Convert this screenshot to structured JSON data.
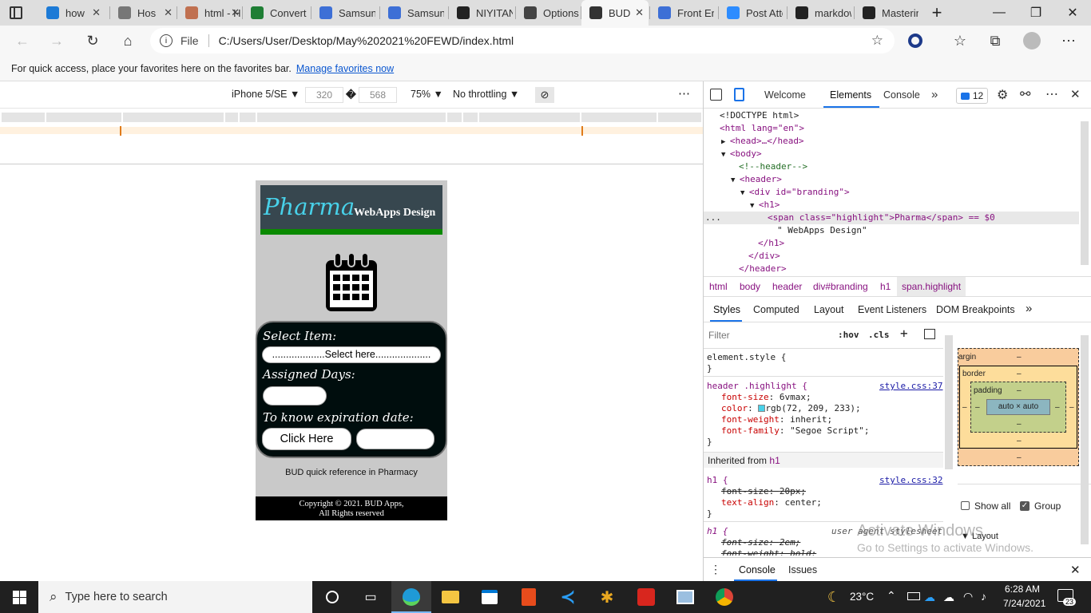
{
  "tabs": [
    {
      "label": "how",
      "icon": "bing-icon",
      "color": "#1c7ad6"
    },
    {
      "label": "Hos",
      "icon": "hosting-icon",
      "color": "#777"
    },
    {
      "label": "html - H",
      "icon": "page-icon",
      "color": "#c07050"
    },
    {
      "label": "Convert",
      "icon": "convert-icon",
      "color": "#1e7e34"
    },
    {
      "label": "Samsung",
      "icon": "samsung-icon",
      "color": "#3d6fd6"
    },
    {
      "label": "Samsung",
      "icon": "samsung-icon",
      "color": "#3d6fd6"
    },
    {
      "label": "NIYITANG",
      "icon": "github-icon",
      "color": "#222"
    },
    {
      "label": "Options",
      "icon": "github-icon",
      "color": "#444"
    },
    {
      "label": "BUD",
      "icon": "document-icon",
      "color": "#333"
    },
    {
      "label": "Front End",
      "icon": "doc-icon",
      "color": "#3d6fd6"
    },
    {
      "label": "Post Atte",
      "icon": "zoom-icon",
      "color": "#2d8cff"
    },
    {
      "label": "markdow",
      "icon": "github-icon",
      "color": "#222"
    },
    {
      "label": "Masterin",
      "icon": "github-icon",
      "color": "#222"
    }
  ],
  "address": {
    "file_label": "File",
    "url": "C:/Users/User/Desktop/May%202021%20FEWD/index.html"
  },
  "favbar": {
    "text": "For quick access, place your favorites here on the favorites bar.",
    "link": "Manage favorites now"
  },
  "device_toolbar": {
    "device": "iPhone 5/SE ▼",
    "width": "320",
    "height": "568",
    "sep": "�",
    "zoom": "75% ▼",
    "throttle": "No throttling ▼"
  },
  "page": {
    "highlight": "Pharma",
    "brand_rest": "WebApps Design",
    "select_item_label": "Select Item:",
    "select_placeholder": "...................Select here....................",
    "assigned_days_label": "Assigned Days:",
    "expiry_label": "To know expiration date:",
    "click_here": "Click Here",
    "footnote": "BUD quick reference in Pharmacy",
    "copyright_line1": "Copyright © 2021. BUD Apps,",
    "copyright_line2": "All Rights reserved",
    "highlight_color": "#48d1e9"
  },
  "devtools": {
    "tabs": [
      "Welcome",
      "Elements",
      "Console"
    ],
    "active_tab": "Elements",
    "issues_count": "12",
    "dom": [
      "<!DOCTYPE html>",
      "<html lang=\"en\">",
      "<head>…</head>",
      "<body>",
      "<!--header-->",
      "<header>",
      "<div id=\"branding\">",
      "<h1>",
      "<span class=\"highlight\">Pharma</span> == $0",
      "\" WebApps Design\"",
      "</h1>",
      "</div>",
      "</header>"
    ],
    "breadcrumbs": [
      "html",
      "body",
      "header",
      "div#branding",
      "h1",
      "span.highlight"
    ],
    "sub_tabs": [
      "Styles",
      "Computed",
      "Layout",
      "Event Listeners",
      "DOM Breakpoints"
    ],
    "filter_placeholder": "Filter",
    "hov": ":hov",
    "cls": ".cls",
    "styles": {
      "element_style": "element.style {",
      "rule1_selector": "header .highlight {",
      "rule1_link": "style.css:37",
      "rule1_props": [
        {
          "name": "font-size",
          "value": "6vmax;"
        },
        {
          "name": "color",
          "value": "rgb(72, 209, 233);"
        },
        {
          "name": "font-weight",
          "value": "inherit;"
        },
        {
          "name": "font-family",
          "value": "\"Segoe Script\";"
        }
      ],
      "inherited_label": "Inherited from",
      "inherited_from": "h1",
      "rule2_selector": "h1 {",
      "rule2_link": "style.css:32",
      "rule2_props": [
        {
          "name": "font-size",
          "value": "20px;"
        },
        {
          "name": "text-align",
          "value": "center;"
        }
      ],
      "rule3_selector": "h1 {",
      "rule3_source": "user agent stylesheet",
      "rule3_props": [
        {
          "name": "font-size",
          "value": "2em;"
        },
        {
          "name": "font-weight",
          "value": "bold;"
        }
      ]
    },
    "box_model": {
      "margin": "argin",
      "border": "border",
      "padding": "padding",
      "content": "auto × auto",
      "dash": "–"
    },
    "show_all": "Show all",
    "group": "Group",
    "layout_label": "Layout",
    "drawer_tabs": [
      "Console",
      "Issues"
    ]
  },
  "watermark": {
    "line1": "Activate Windows",
    "line2": "Go to Settings to activate Windows."
  },
  "taskbar": {
    "search_placeholder": "Type here to search",
    "temperature": "23°C",
    "time": "6:28 AM",
    "date": "7/24/2021",
    "notifications": "23"
  }
}
